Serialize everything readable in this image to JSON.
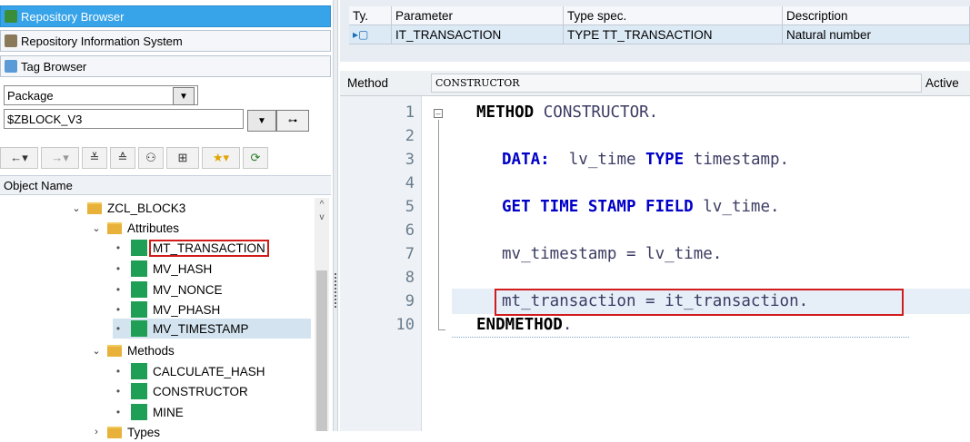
{
  "nav": {
    "repository_browser": "Repository Browser",
    "repository_info_system": "Repository Information System",
    "tag_browser": "Tag Browser"
  },
  "selector": {
    "type_value": "Package",
    "package_value": "$ZBLOCK_V3"
  },
  "tree": {
    "header": "Object Name",
    "class_name": "ZCL_BLOCK3",
    "attributes_folder": "Attributes",
    "attributes": [
      "MT_TRANSACTION",
      "MV_HASH",
      "MV_NONCE",
      "MV_PHASH",
      "MV_TIMESTAMP"
    ],
    "methods_folder": "Methods",
    "methods": [
      "CALCULATE_HASH",
      "CONSTRUCTOR",
      "MINE"
    ],
    "types_folder": "Types"
  },
  "params": {
    "headers": [
      "Ty.",
      "Parameter",
      "Type spec.",
      "Description"
    ],
    "rows": [
      {
        "type_icon": "importing-arrow-icon",
        "parameter": "IT_TRANSACTION",
        "type_spec": "TYPE TT_TRANSACTION",
        "description": "Natural number"
      }
    ]
  },
  "method_bar": {
    "label": "Method",
    "name": "CONSTRUCTOR",
    "status": "Active"
  },
  "editor": {
    "line_numbers": [
      "1",
      "2",
      "3",
      "4",
      "5",
      "6",
      "7",
      "8",
      "9",
      "10"
    ],
    "lines": {
      "l1_kw": "METHOD",
      "l1_rest": " CONSTRUCTOR.",
      "l3_kw": "DATA:",
      "l3_a": "  lv_time ",
      "l3_kw2": "TYPE",
      "l3_b": " timestamp.",
      "l5_kw": "GET TIME STAMP FIELD",
      "l5_b": " lv_time.",
      "l7": "mv_timestamp = lv_time.",
      "l9": "mt_transaction = it_transaction.",
      "l10_kw": "ENDMETHOD",
      "l10_b": "."
    }
  },
  "colors": {
    "accent": "#37a3e8",
    "highlight_box": "#d21c1c",
    "class_icon": "#1f9e55",
    "keyword": "#0000c8"
  }
}
